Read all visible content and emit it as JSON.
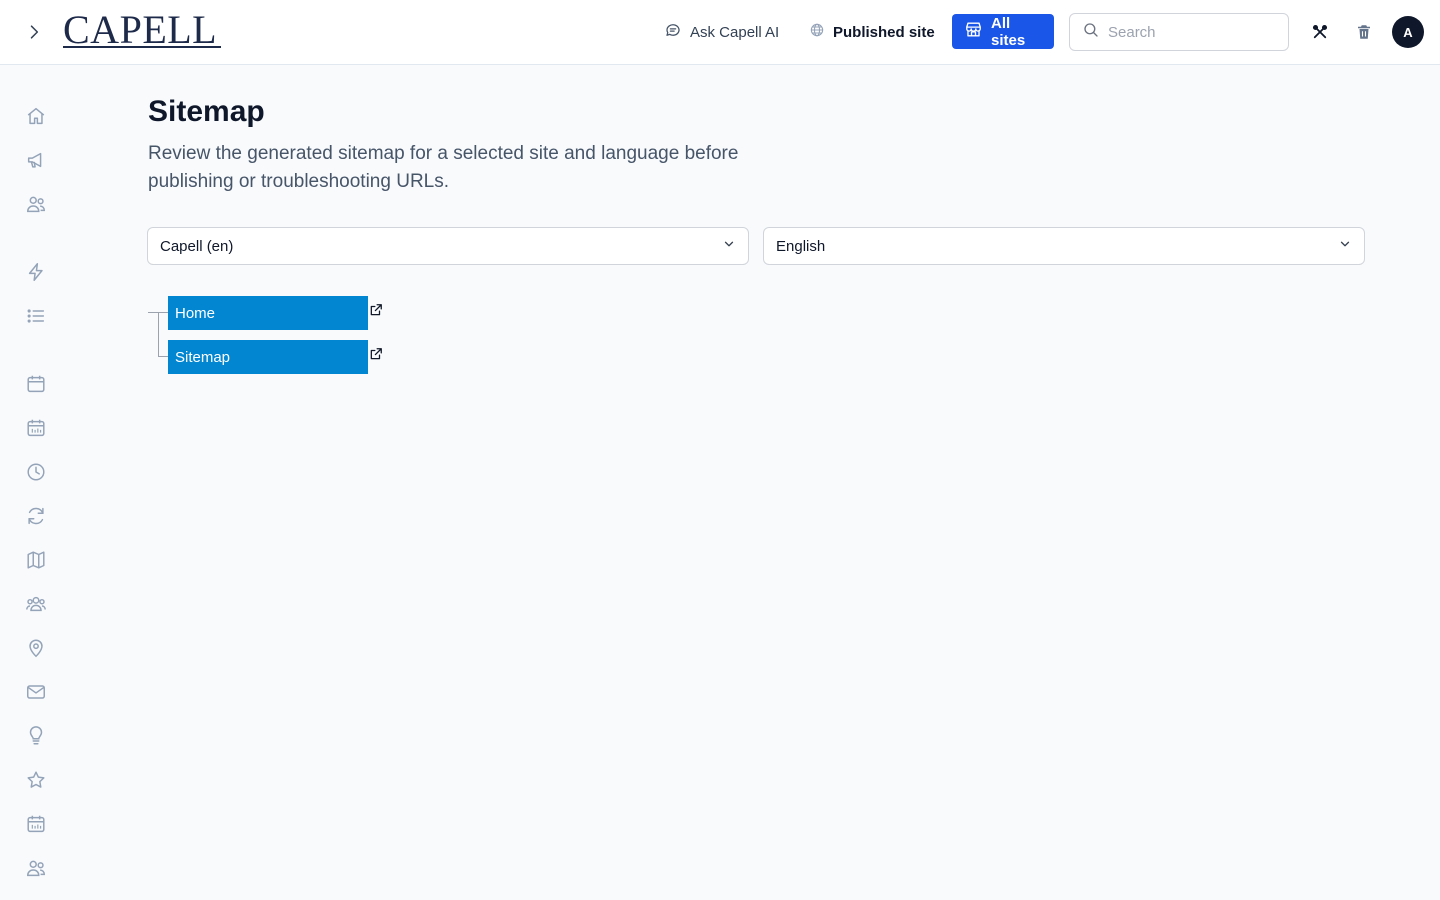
{
  "header": {
    "logo_text": "CAPELL",
    "ask_ai_label": "Ask Capell AI",
    "published_site_label": "Published site",
    "all_sites_label": "All sites",
    "search_placeholder": "Search",
    "avatar_initial": "A"
  },
  "sidebar": {
    "icons": [
      "home-icon",
      "megaphone-icon",
      "users-icon",
      "bolt-icon",
      "list-icon",
      "calendar-icon",
      "calendar-days-icon",
      "clock-icon",
      "refresh-icon",
      "map-icon",
      "user-group-icon",
      "map-pin-icon",
      "envelope-icon",
      "light-bulb-icon",
      "star-icon",
      "calendar-days-icon",
      "users-icon"
    ]
  },
  "main": {
    "title": "Sitemap",
    "description": "Review the generated sitemap for a selected site and language before publishing or troubleshooting URLs.",
    "site_select": "Capell (en)",
    "language_select": "English",
    "tree": [
      {
        "label": "Home"
      },
      {
        "label": "Sitemap"
      }
    ]
  },
  "colors": {
    "primary_button": "#1a56e8",
    "tree_node": "#0386d1",
    "page_background": "#f8fafc"
  }
}
